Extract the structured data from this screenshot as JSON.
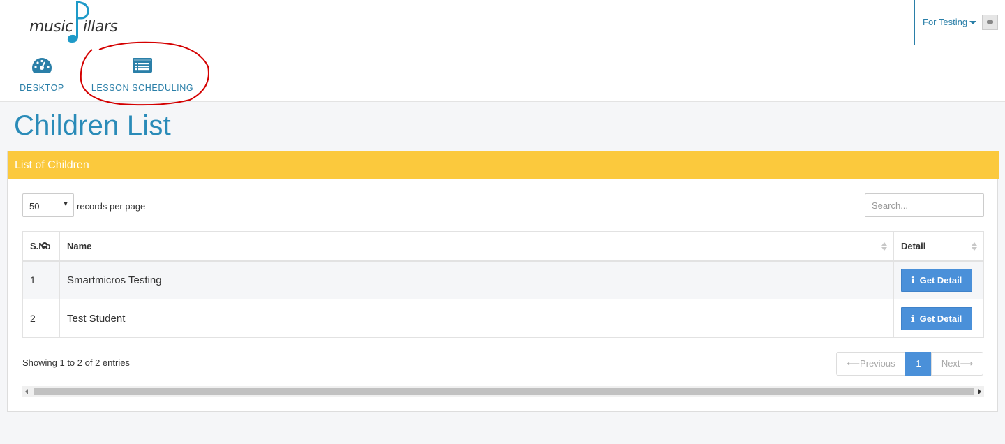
{
  "header": {
    "logo_text": "musicPillars",
    "user_name": "For Testing"
  },
  "nav": {
    "items": [
      {
        "label": "DESKTOP",
        "icon": "dashboard-icon"
      },
      {
        "label": "LESSON SCHEDULING",
        "icon": "list-icon"
      }
    ]
  },
  "page": {
    "title": "Children List"
  },
  "panel": {
    "title": "List of Children",
    "length_value": "50",
    "length_label": "records per page",
    "search_placeholder": "Search..."
  },
  "table": {
    "columns": [
      "S.No",
      "Name",
      "Detail"
    ],
    "rows": [
      {
        "sno": "1",
        "name": "Smartmicros Testing",
        "action": "Get Detail"
      },
      {
        "sno": "2",
        "name": "Test Student",
        "action": "Get Detail"
      }
    ]
  },
  "footer": {
    "info": "Showing 1 to 2 of 2 entries",
    "prev": "Previous",
    "current_page": "1",
    "next": "Next"
  },
  "colors": {
    "brand": "#2a7fa8",
    "panel_header": "#fbc93d",
    "button": "#4a90d9",
    "annotation": "#d40000"
  }
}
